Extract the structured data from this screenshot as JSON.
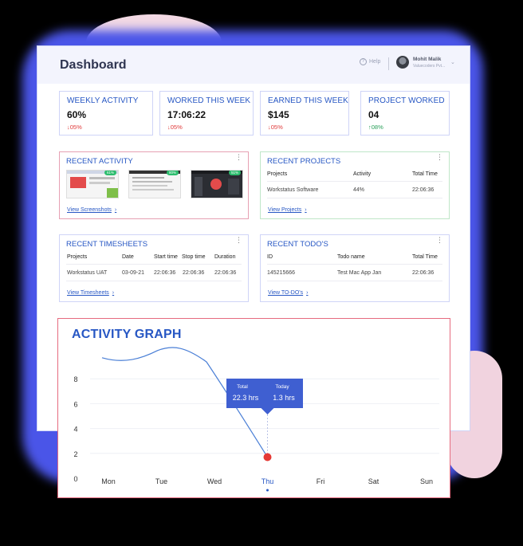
{
  "header": {
    "title": "Dashboard",
    "help_label": "Help",
    "help_icon": "?",
    "user_name": "Mohit Malik",
    "user_org": "Valuecoders Pvt..."
  },
  "stats": [
    {
      "label": "WEEKLY ACTIVITY",
      "value": "60%",
      "delta": "05%",
      "dir": "down"
    },
    {
      "label": "WORKED THIS WEEK",
      "value": "17:06:22",
      "delta": "05%",
      "dir": "down"
    },
    {
      "label": "EARNED THIS WEEK",
      "value": "$145",
      "delta": "05%",
      "dir": "down"
    },
    {
      "label": "PROJECT WORKED",
      "value": "04",
      "delta": "08%",
      "dir": "up"
    }
  ],
  "recent_activity": {
    "title": "RECENT ACTIVITY",
    "link": "View Screenshots",
    "shots": [
      {
        "badge": "61%"
      },
      {
        "badge": "80%"
      },
      {
        "badge": "51%"
      }
    ]
  },
  "recent_projects": {
    "title": "RECENT PROJECTS",
    "columns": [
      "Projects",
      "Activity",
      "Total Time"
    ],
    "rows": [
      [
        "Workstatus Software",
        "44%",
        "22:06:36"
      ]
    ],
    "link": "View Projects"
  },
  "recent_timesheets": {
    "title": "RECENT TIMESHEETS",
    "columns": [
      "Projects",
      "Date",
      "Start time",
      "Stop time",
      "Duration"
    ],
    "rows": [
      [
        "Workstatus UAT",
        "03-09-21",
        "22:06:36",
        "22:06:36",
        "22:06:36"
      ]
    ],
    "link": "View Timesheets"
  },
  "recent_todos": {
    "title": "RECENT TODO'S",
    "columns": [
      "ID",
      "Todo name",
      "Total Time"
    ],
    "rows": [
      [
        "145215666",
        "Test Mac App Jan",
        "22:06:36"
      ]
    ],
    "link": "View TO-DO's"
  },
  "chart_data": {
    "type": "line",
    "title": "ACTIVITY GRAPH",
    "categories": [
      "Mon",
      "Tue",
      "Wed",
      "Thu",
      "Fri",
      "Sat",
      "Sun"
    ],
    "y_ticks": [
      "0",
      "2",
      "4",
      "6",
      "8"
    ],
    "ylim": [
      0,
      10
    ],
    "series": [
      {
        "values": [
          9.5,
          9.5,
          10,
          1.7
        ]
      }
    ],
    "highlighted_category": "Thu",
    "line_color": "#4a7fd6",
    "marker_color": "#e53935",
    "grid": true,
    "tooltip": {
      "left_label": "Total",
      "left_value": "22.3 hrs",
      "right_label": "Today",
      "right_value": "1.3 hrs",
      "color": "#3f5fd1"
    }
  }
}
